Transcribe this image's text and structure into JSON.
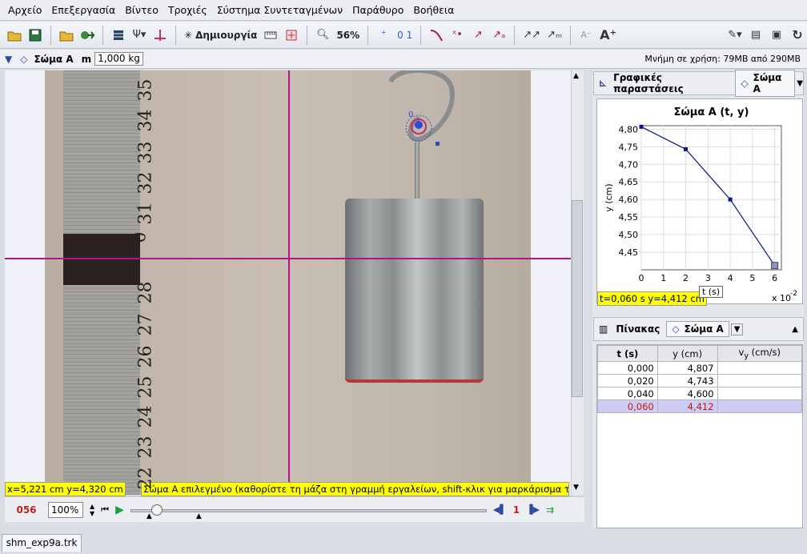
{
  "menu": [
    "Αρχείο",
    "Επεξεργασία",
    "Βίντεο",
    "Τροχιές",
    "Σύστημα Συντεταγμένων",
    "Παράθυρο",
    "Βοήθεια"
  ],
  "toolbar": {
    "create_label": "Δημιουργία",
    "zoom_label": "56%",
    "vec_label": "0 1"
  },
  "trackbar": {
    "track_name": "Σώμα A",
    "mass_label": "m",
    "mass_value": "1,000 kg",
    "memory": "Μνήμη σε χρήση: 79MB από 290MB"
  },
  "ruler_numbers": [
    "35",
    "34",
    "33",
    "32",
    "31",
    "0",
    "28",
    "27",
    "26",
    "25",
    "24",
    "23",
    "22"
  ],
  "video": {
    "status_xy": "x=5,221 cm  y=4,320 cm",
    "status_msg": "Σώμα A επιλεγμένο (καθορίστε τη μάζα στη γραμμή εργαλείων, shift-κλικ για μαρκάρισμα των θέσεων)",
    "point_label": "0"
  },
  "player": {
    "frame": "056",
    "zoom": "100%",
    "step": "1"
  },
  "file_tab": "shm_exp9a.trk",
  "plot_panel": {
    "tab_label": "Γραφικές παραστάσεις",
    "track": "Σώμα A"
  },
  "table_panel": {
    "tab_label": "Πίνακας",
    "track": "Σώμα A"
  },
  "chart_data": {
    "type": "line",
    "title": "Σώμα A (t, y)",
    "xlabel": "t (s)",
    "ylabel": "y (cm)",
    "x_scale_note": "x 10",
    "x_scale_exp": "-2",
    "x": [
      0,
      2,
      4,
      6
    ],
    "y": [
      4.807,
      4.743,
      4.6,
      4.412
    ],
    "xlim": [
      0,
      6.3
    ],
    "ylim": [
      4.4,
      4.81
    ],
    "xticks": [
      "0",
      "1",
      "2",
      "3",
      "4",
      "5",
      "6"
    ],
    "yticks": [
      "4,80",
      "4,75",
      "4,70",
      "4,65",
      "4,60",
      "4,55",
      "4,50",
      "4,45"
    ],
    "grid": true
  },
  "readout": "t=0,060 s  y=4,412 cm",
  "table": {
    "headers": [
      "t (s)",
      "y (cm)",
      "v"
    ],
    "header_v_sub": "y",
    "header_v_unit": " (cm/s)",
    "rows": [
      [
        "0,000",
        "4,807",
        ""
      ],
      [
        "0,020",
        "4,743",
        ""
      ],
      [
        "0,040",
        "4,600",
        ""
      ],
      [
        "0,060",
        "4,412",
        ""
      ]
    ],
    "selected_row": 3
  }
}
